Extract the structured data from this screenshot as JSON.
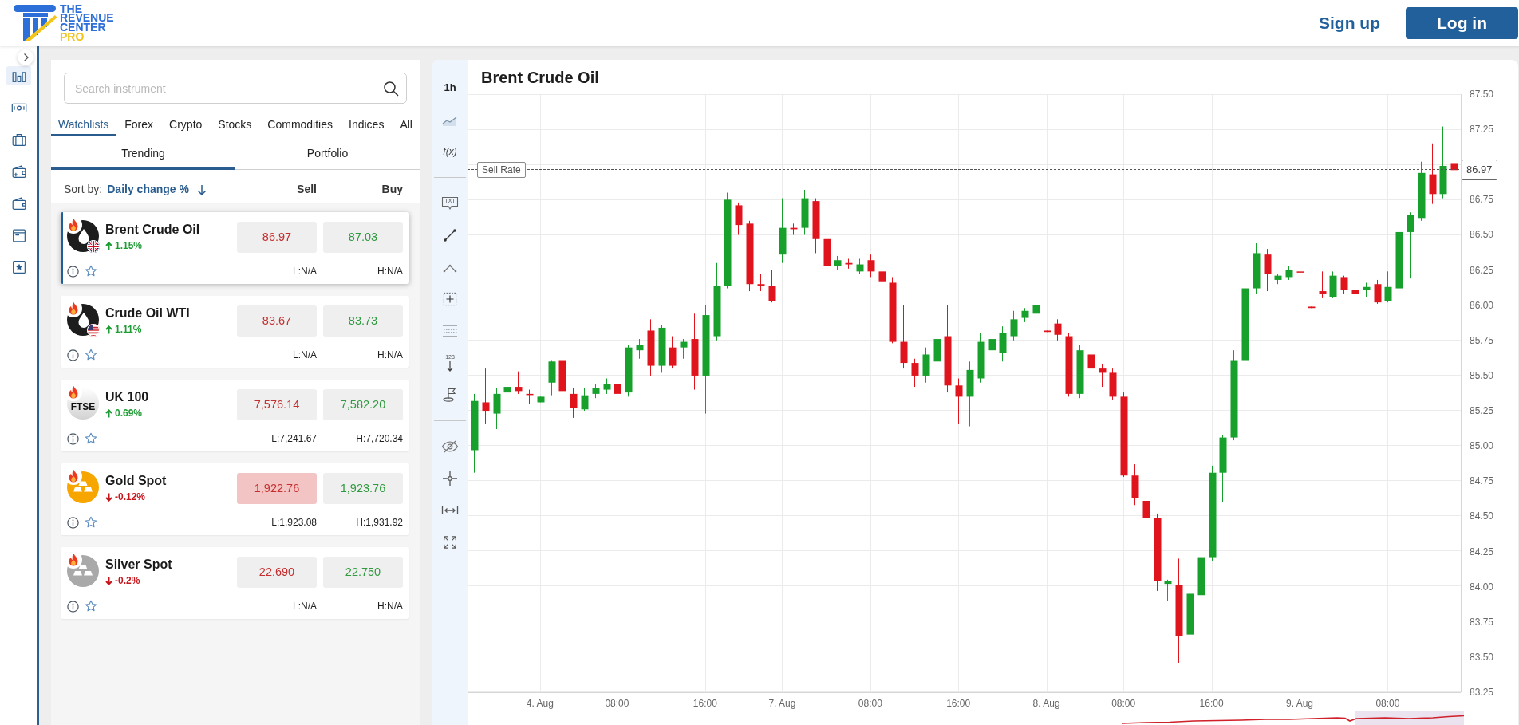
{
  "header": {
    "logo_lines": [
      {
        "text": "THE",
        "color": "#2f6fd8"
      },
      {
        "text": "REVENUE",
        "color": "#2f6fd8"
      },
      {
        "text": "CENTER",
        "color": "#2f6fd8"
      },
      {
        "text": "PRO",
        "color": "#f2c318"
      }
    ],
    "sign_up": "Sign up",
    "log_in": "Log in"
  },
  "nav_rail": {
    "items": [
      {
        "kind": "chart",
        "selected": true
      },
      {
        "kind": "cash",
        "selected": false
      },
      {
        "kind": "briefcase",
        "selected": false
      },
      {
        "kind": "addwallet",
        "selected": false
      },
      {
        "kind": "wallet",
        "selected": false
      },
      {
        "kind": "window",
        "selected": false
      },
      {
        "kind": "favorites",
        "selected": false
      }
    ]
  },
  "watchlist": {
    "search": {
      "placeholder": "Search instrument"
    },
    "tabs": [
      {
        "label": "Watchlists",
        "selected": true
      },
      {
        "label": "Forex",
        "selected": false
      },
      {
        "label": "Crypto",
        "selected": false
      },
      {
        "label": "Stocks",
        "selected": false
      },
      {
        "label": "Commodities",
        "selected": false
      },
      {
        "label": "Indices",
        "selected": false
      },
      {
        "label": "All",
        "selected": false
      }
    ],
    "subtabs": [
      {
        "label": "Trending",
        "selected": true
      },
      {
        "label": "Portfolio",
        "selected": false
      }
    ],
    "sort": {
      "label": "Sort by:",
      "field": "Daily change %",
      "columns": [
        "Sell",
        "Buy"
      ]
    },
    "instruments": [
      {
        "name": "Brent Crude Oil",
        "kind": "oil",
        "flag": {
          "kind": "uk"
        },
        "trending": true,
        "selected": true,
        "rising": true,
        "change": "1.15%",
        "sell": "86.97",
        "buy": "87.03",
        "sell_flash": false,
        "low": "L:N/A",
        "high": "H:N/A",
        "favorite": false
      },
      {
        "name": "Crude Oil WTI",
        "kind": "oil",
        "flag": {
          "kind": "us"
        },
        "trending": true,
        "selected": false,
        "rising": true,
        "change": "1.11%",
        "sell": "83.67",
        "buy": "83.73",
        "sell_flash": false,
        "low": "L:N/A",
        "high": "H:N/A",
        "favorite": false
      },
      {
        "name": "UK 100",
        "kind": "index",
        "logo_text": "FTSE",
        "trending": true,
        "selected": false,
        "rising": true,
        "change": "0.69%",
        "sell": "7,576.14",
        "buy": "7,582.20",
        "sell_flash": false,
        "low": "L:7,241.67",
        "high": "H:7,720.34",
        "favorite": false
      },
      {
        "name": "Gold Spot",
        "kind": "gold",
        "trending": true,
        "selected": false,
        "rising": false,
        "change": "-0.12%",
        "sell": "1,922.76",
        "buy": "1,923.76",
        "sell_flash": true,
        "low": "L:1,923.08",
        "high": "H:1,931.92",
        "favorite": false
      },
      {
        "name": "Silver Spot",
        "kind": "silver",
        "trending": true,
        "selected": false,
        "rising": false,
        "change": "-0.2%",
        "sell": "22.690",
        "buy": "22.750",
        "sell_flash": false,
        "low": "L:N/A",
        "high": "H:N/A",
        "favorite": false
      }
    ]
  },
  "chart": {
    "toolbar": {
      "groups": [
        {
          "items": [
            {
              "kind": "interval",
              "label": "1h"
            },
            {
              "kind": "area"
            },
            {
              "kind": "function",
              "label": "f(x)"
            }
          ]
        },
        {
          "items": [
            {
              "kind": "note",
              "label": "TXT"
            },
            {
              "kind": "line"
            },
            {
              "kind": "angle"
            },
            {
              "kind": "zoombox"
            },
            {
              "kind": "levels"
            },
            {
              "kind": "measure",
              "label": "123"
            },
            {
              "kind": "flag"
            }
          ]
        },
        {
          "items": [
            {
              "kind": "hide"
            },
            {
              "kind": "crosshair"
            },
            {
              "kind": "fit"
            },
            {
              "kind": "fullscreen"
            }
          ]
        }
      ]
    },
    "title": "Brent Crude Oil",
    "chart_data": {
      "type": "candlestick",
      "grid": true,
      "ylim": [
        83.25,
        87.5
      ],
      "yticks": [
        {
          "value": 87.5,
          "label": "87.50"
        },
        {
          "value": 87.25,
          "label": "87.25"
        },
        {
          "value": 86.75,
          "label": "86.75"
        },
        {
          "value": 86.5,
          "label": "86.50"
        },
        {
          "value": 86.25,
          "label": "86.25"
        },
        {
          "value": 86,
          "label": "86.00"
        },
        {
          "value": 85.75,
          "label": "85.75"
        },
        {
          "value": 85.5,
          "label": "85.50"
        },
        {
          "value": 85.25,
          "label": "85.25"
        },
        {
          "value": 85,
          "label": "85.00"
        },
        {
          "value": 84.75,
          "label": "84.75"
        },
        {
          "value": 84.5,
          "label": "84.50"
        },
        {
          "value": 84.25,
          "label": "84.25"
        },
        {
          "value": 84,
          "label": "84.00"
        },
        {
          "value": 83.75,
          "label": "83.75"
        },
        {
          "value": 83.5,
          "label": "83.50"
        },
        {
          "value": 83.25,
          "label": "83.25"
        }
      ],
      "ref_lines": [
        {
          "axis": "y",
          "value": 86.97,
          "label": "Sell Rate"
        }
      ],
      "annotations": [
        "86.97"
      ],
      "categories": [
        null,
        null,
        null,
        null,
        null,
        null,
        "4. Aug",
        null,
        null,
        null,
        null,
        null,
        null,
        "08:00",
        null,
        null,
        null,
        null,
        null,
        null,
        null,
        "16:00",
        null,
        null,
        null,
        null,
        null,
        null,
        "7. Aug",
        null,
        null,
        null,
        null,
        null,
        null,
        null,
        "08:00",
        null,
        null,
        null,
        null,
        null,
        null,
        null,
        "16:00",
        null,
        null,
        null,
        null,
        null,
        null,
        null,
        "8. Aug",
        null,
        null,
        null,
        null,
        null,
        null,
        "08:00",
        null,
        null,
        null,
        null,
        null,
        null,
        null,
        "16:00",
        null,
        null,
        null,
        null,
        null,
        null,
        null,
        "9. Aug",
        null,
        null,
        null,
        null,
        null,
        null,
        null,
        "08:00",
        null,
        null,
        null,
        null,
        null,
        null
      ],
      "ohlc": [
        [
          84.97,
          85.37,
          84.81,
          85.32
        ],
        [
          85.31,
          85.55,
          85.16,
          85.25
        ],
        [
          85.23,
          85.41,
          85.12,
          85.37
        ],
        [
          85.38,
          85.46,
          85.3,
          85.42
        ],
        [
          85.42,
          85.53,
          85.37,
          85.39
        ],
        [
          85.37,
          85.4,
          85.3,
          85.37
        ],
        [
          85.31,
          85.35,
          85.31,
          85.35
        ],
        [
          85.45,
          85.61,
          85.36,
          85.6
        ],
        [
          85.61,
          85.73,
          85.33,
          85.39
        ],
        [
          85.37,
          85.41,
          85.2,
          85.27
        ],
        [
          85.26,
          85.41,
          85.25,
          85.36
        ],
        [
          85.37,
          85.44,
          85.34,
          85.41
        ],
        [
          85.4,
          85.48,
          85.37,
          85.44
        ],
        [
          85.44,
          85.45,
          85.3,
          85.37
        ],
        [
          85.38,
          85.72,
          85.35,
          85.7
        ],
        [
          85.68,
          85.76,
          85.62,
          85.72
        ],
        [
          85.82,
          85.9,
          85.5,
          85.57
        ],
        [
          85.57,
          85.86,
          85.52,
          85.84
        ],
        [
          85.7,
          85.78,
          85.55,
          85.57
        ],
        [
          85.7,
          85.76,
          85.62,
          85.74
        ],
        [
          85.76,
          85.94,
          85.4,
          85.5
        ],
        [
          85.5,
          86.0,
          85.23,
          85.93
        ],
        [
          85.78,
          86.3,
          85.75,
          86.14
        ],
        [
          86.14,
          86.8,
          86.12,
          86.75
        ],
        [
          86.71,
          86.73,
          86.5,
          86.57
        ],
        [
          86.58,
          86.6,
          86.1,
          86.15
        ],
        [
          86.15,
          86.22,
          86.1,
          86.14
        ],
        [
          86.14,
          86.25,
          86.02,
          86.03
        ],
        [
          86.36,
          86.76,
          86.3,
          86.55
        ],
        [
          86.55,
          86.58,
          86.5,
          86.54
        ],
        [
          86.55,
          86.82,
          86.5,
          86.76
        ],
        [
          86.74,
          86.76,
          86.37,
          86.47
        ],
        [
          86.47,
          86.52,
          86.25,
          86.28
        ],
        [
          86.28,
          86.35,
          86.25,
          86.32
        ],
        [
          86.3,
          86.33,
          86.26,
          86.29
        ],
        [
          86.24,
          86.33,
          86.22,
          86.29
        ],
        [
          86.32,
          86.36,
          86.2,
          86.24
        ],
        [
          86.24,
          86.28,
          86.12,
          86.17
        ],
        [
          86.16,
          86.2,
          85.73,
          85.74
        ],
        [
          85.74,
          86.0,
          85.55,
          85.59
        ],
        [
          85.59,
          85.62,
          85.42,
          85.5
        ],
        [
          85.5,
          85.7,
          85.45,
          85.65
        ],
        [
          85.6,
          85.8,
          85.5,
          85.76
        ],
        [
          85.78,
          86.0,
          85.38,
          85.43
        ],
        [
          85.43,
          85.48,
          85.16,
          85.35
        ],
        [
          85.35,
          85.6,
          85.14,
          85.54
        ],
        [
          85.48,
          85.8,
          85.45,
          85.74
        ],
        [
          85.68,
          86.0,
          85.6,
          85.76
        ],
        [
          85.66,
          85.85,
          85.6,
          85.8
        ],
        [
          85.78,
          85.96,
          85.75,
          85.9
        ],
        [
          85.91,
          85.98,
          85.88,
          85.96
        ],
        [
          85.94,
          86.02,
          85.92,
          86.0
        ],
        [
          85.82,
          85.82,
          85.81,
          85.81
        ],
        [
          85.87,
          85.9,
          85.75,
          85.79
        ],
        [
          85.78,
          85.8,
          85.35,
          85.37
        ],
        [
          85.37,
          85.72,
          85.34,
          85.68
        ],
        [
          85.65,
          85.7,
          85.5,
          85.55
        ],
        [
          85.55,
          85.58,
          85.42,
          85.52
        ],
        [
          85.52,
          85.55,
          85.33,
          85.35
        ],
        [
          85.35,
          85.38,
          84.78,
          84.79
        ],
        [
          84.79,
          84.87,
          84.58,
          84.63
        ],
        [
          84.61,
          84.82,
          84.32,
          84.49
        ],
        [
          84.49,
          84.52,
          83.97,
          84.04
        ],
        [
          84.02,
          84.05,
          83.9,
          84.04
        ],
        [
          84.01,
          84.2,
          83.46,
          83.65
        ],
        [
          83.66,
          83.98,
          83.42,
          83.95
        ],
        [
          83.94,
          84.42,
          83.9,
          84.21
        ],
        [
          84.21,
          84.86,
          84.18,
          84.81
        ],
        [
          84.81,
          85.08,
          84.6,
          85.06
        ],
        [
          85.06,
          85.68,
          85.04,
          85.61
        ],
        [
          85.61,
          86.15,
          85.6,
          86.12
        ],
        [
          86.12,
          86.44,
          86.08,
          86.37
        ],
        [
          86.36,
          86.4,
          86.1,
          86.22
        ],
        [
          86.18,
          86.22,
          86.15,
          86.21
        ],
        [
          86.2,
          86.28,
          86.18,
          86.25
        ],
        [
          86.24,
          86.24,
          86.23,
          86.24
        ],
        [
          85.99,
          85.99,
          85.98,
          85.98
        ],
        [
          86.1,
          86.24,
          86.05,
          86.08
        ],
        [
          86.06,
          86.24,
          86.05,
          86.21
        ],
        [
          86.2,
          86.21,
          86.08,
          86.11
        ],
        [
          86.11,
          86.14,
          86.06,
          86.08
        ],
        [
          86.11,
          86.16,
          86.06,
          86.13
        ],
        [
          86.15,
          86.18,
          86.01,
          86.02
        ],
        [
          86.03,
          86.24,
          86.02,
          86.13
        ],
        [
          86.12,
          86.53,
          86.08,
          86.52
        ],
        [
          86.52,
          86.66,
          86.19,
          86.64
        ],
        [
          86.62,
          87.02,
          86.6,
          86.94
        ],
        [
          86.93,
          87.15,
          86.72,
          86.79
        ],
        [
          86.79,
          87.27,
          86.76,
          86.99
        ],
        [
          87.01,
          87.07,
          86.9,
          86.96
        ]
      ]
    }
  }
}
